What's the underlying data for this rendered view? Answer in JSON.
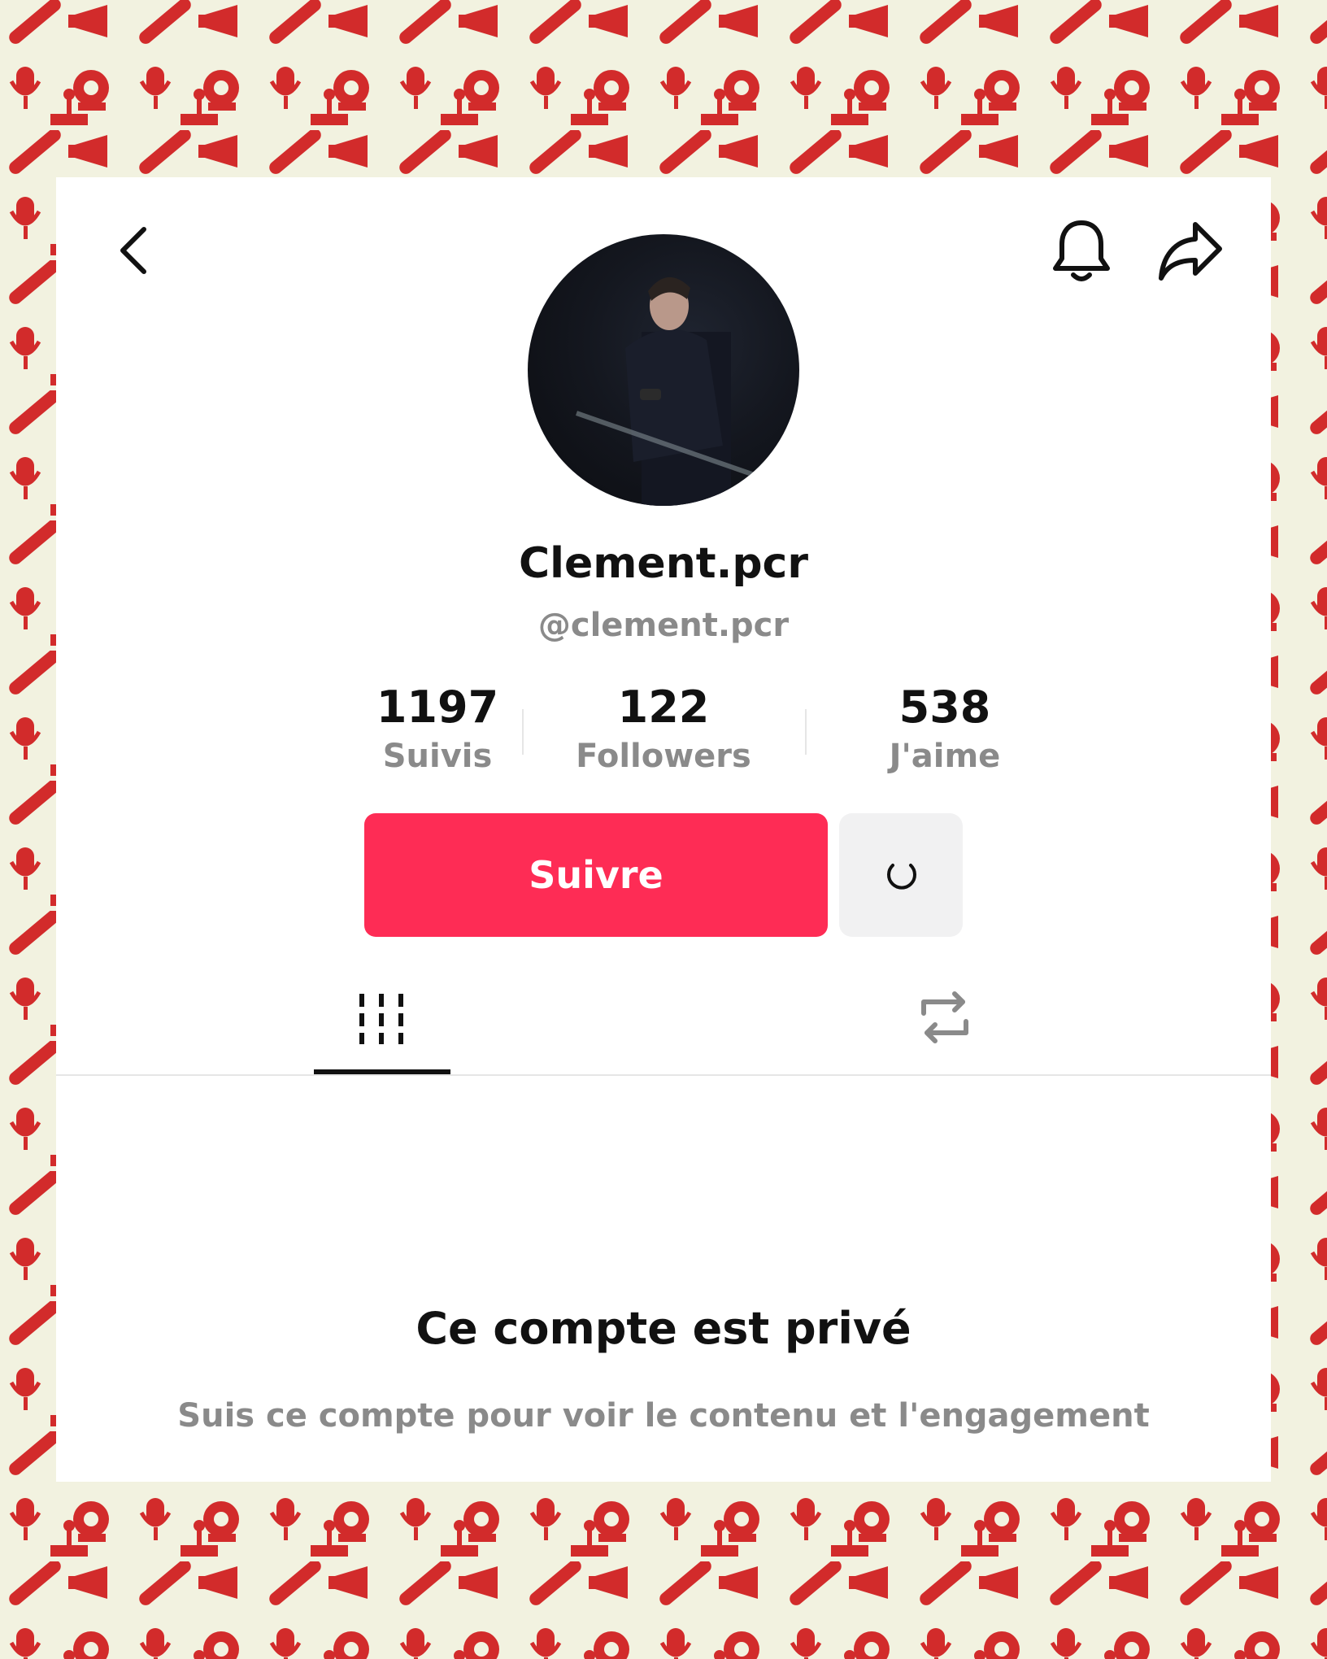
{
  "colors": {
    "background": "#f2f2e0",
    "pattern": "#d22b2b",
    "accent": "#fe2c55",
    "text_primary": "#111111",
    "text_secondary": "#8a8a8a"
  },
  "header": {
    "back_icon": "chevron-left-icon",
    "notification_icon": "bell-icon",
    "share_icon": "share-arrow-icon"
  },
  "profile": {
    "display_name": "Clement.pcr",
    "username": "@clement.pcr",
    "avatar_icon": "profile-photo"
  },
  "stats": [
    {
      "value": "1197",
      "label": "Suivis"
    },
    {
      "value": "122",
      "label": "Followers"
    },
    {
      "value": "538",
      "label": "J'aime"
    }
  ],
  "actions": {
    "follow_label": "Suivre",
    "suggest_icon": "refresh-circle-icon"
  },
  "tabs": [
    {
      "icon": "videos-grid-icon",
      "active": true
    },
    {
      "icon": "repost-icon",
      "active": false
    }
  ],
  "private_notice": {
    "title": "Ce compte est privé",
    "subtitle": "Suis ce compte pour voir le contenu et l'engagement"
  }
}
